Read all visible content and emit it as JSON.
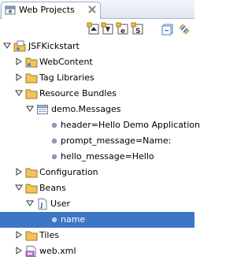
{
  "view": {
    "title": "Web Projects",
    "close_icon": "close-x-icon",
    "view_icon": "web-projects-view-icon"
  },
  "toolbar": {
    "buttons": [
      {
        "icon": "new-action-icon"
      },
      {
        "icon": "new-bean-icon"
      },
      {
        "icon": "new-page-icon"
      },
      {
        "icon": "new-script-icon"
      },
      {
        "icon": "collapse-all-icon"
      },
      {
        "icon": "link-with-editor-icon"
      }
    ]
  },
  "tree": {
    "items": [
      {
        "label": "JSFKickstart",
        "icon": "project-icon",
        "expanded": true
      },
      {
        "label": "WebContent",
        "icon": "folder-icon",
        "expanded": false
      },
      {
        "label": "Tag Libraries",
        "icon": "folder-icon",
        "expanded": false
      },
      {
        "label": "Resource Bundles",
        "icon": "folder-icon",
        "expanded": true
      },
      {
        "label": "demo.Messages",
        "icon": "properties-file-icon",
        "expanded": true
      },
      {
        "label": "header=Hello Demo Application",
        "icon": "property-icon"
      },
      {
        "label": "prompt_message=Name:",
        "icon": "property-icon"
      },
      {
        "label": "hello_message=Hello",
        "icon": "property-icon"
      },
      {
        "label": "Configuration",
        "icon": "folder-icon",
        "expanded": false
      },
      {
        "label": "Beans",
        "icon": "folder-icon",
        "expanded": true
      },
      {
        "label": "User",
        "icon": "java-class-icon",
        "expanded": true
      },
      {
        "label": "name",
        "icon": "property-icon",
        "selected": true
      },
      {
        "label": "Tiles",
        "icon": "folder-icon",
        "expanded": false
      },
      {
        "label": "web.xml",
        "icon": "xml-file-icon",
        "expanded": false
      }
    ]
  },
  "colors": {
    "selection": "#3d76c4",
    "folder": "#f3c45a",
    "titlebar": "#dde6f1"
  }
}
